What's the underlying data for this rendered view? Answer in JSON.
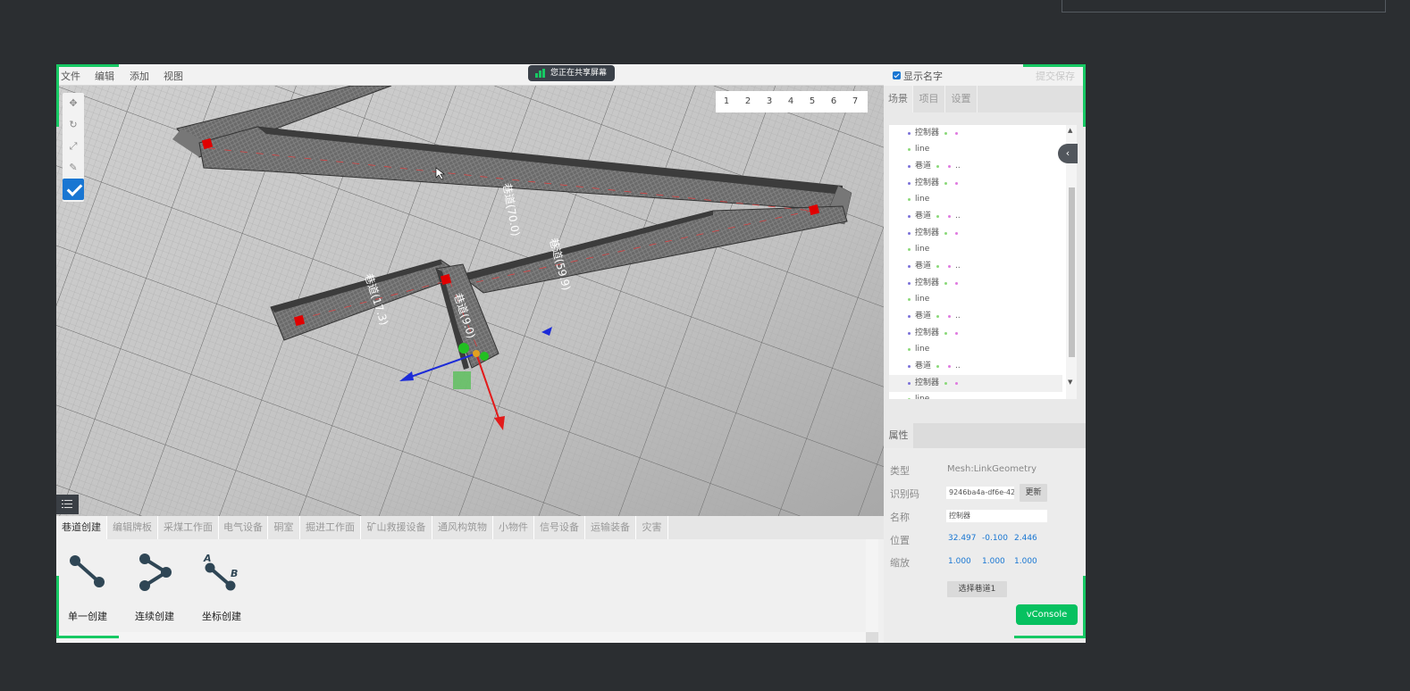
{
  "menu": [
    "文件",
    "编辑",
    "添加",
    "视图"
  ],
  "share_banner": "您正在共享屏幕",
  "show_names": {
    "label": "显示名字",
    "checked": true
  },
  "submit_label": "提交保存",
  "toolbar_icons": [
    "move-icon",
    "rotate-icon",
    "scale-icon",
    "edit-icon"
  ],
  "page_tabs": [
    "1",
    "2",
    "3",
    "4",
    "5",
    "6",
    "7"
  ],
  "scene_labels": [
    "巷道(70.0)",
    "巷道(59.9)",
    "巷道(17.3)",
    "巷道(9.0)"
  ],
  "bottom_tabs": [
    "巷道创建",
    "编辑牌板",
    "采煤工作面",
    "电气设备",
    "硐室",
    "掘进工作面",
    "矿山救援设备",
    "通风构筑物",
    "小物件",
    "信号设备",
    "运输装备",
    "灾害"
  ],
  "create_tools": [
    {
      "label": "单一创建",
      "icon": "single-create-icon"
    },
    {
      "label": "连续创建",
      "icon": "continuous-create-icon"
    },
    {
      "label": "坐标创建",
      "icon": "coordinate-create-icon"
    }
  ],
  "right_tabs": [
    "场景",
    "项目",
    "设置"
  ],
  "tree_rows": [
    {
      "label": "控制器",
      "type": "ctrl"
    },
    {
      "label": "line",
      "type": "line"
    },
    {
      "label": "巷道",
      "type": "tunnel",
      "suffix": ".."
    },
    {
      "label": "控制器",
      "type": "ctrl"
    },
    {
      "label": "line",
      "type": "line"
    },
    {
      "label": "巷道",
      "type": "tunnel",
      "suffix": ".."
    },
    {
      "label": "控制器",
      "type": "ctrl"
    },
    {
      "label": "line",
      "type": "line"
    },
    {
      "label": "巷道",
      "type": "tunnel",
      "suffix": ".."
    },
    {
      "label": "控制器",
      "type": "ctrl"
    },
    {
      "label": "line",
      "type": "line"
    },
    {
      "label": "巷道",
      "type": "tunnel",
      "suffix": ".."
    },
    {
      "label": "控制器",
      "type": "ctrl"
    },
    {
      "label": "line",
      "type": "line"
    },
    {
      "label": "巷道",
      "type": "tunnel",
      "suffix": ".."
    },
    {
      "label": "控制器",
      "type": "ctrl"
    },
    {
      "label": "line",
      "type": "line"
    }
  ],
  "properties": {
    "title": "属性",
    "type_label": "类型",
    "type_value": "Mesh:LinkGeometry",
    "id_label": "识别码",
    "id_value": "9246ba4a-df6e-42",
    "update_label": "更新",
    "name_label": "名称",
    "name_value": "控制器",
    "position_label": "位置",
    "position": [
      "32.497",
      "-0.100",
      "2.446"
    ],
    "scale_label": "缩放",
    "scale": [
      "1.000",
      "1.000",
      "1.000"
    ],
    "select_button": "选择巷道1"
  },
  "vconsole_label": "vConsole",
  "colors": {
    "accent": "#17c964",
    "checkbox": "#1976d2",
    "vconsole": "#07c160",
    "dark_bg": "#2b2e31",
    "marker": "#e00000"
  }
}
